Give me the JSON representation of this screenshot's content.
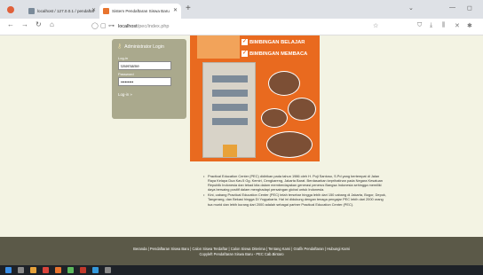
{
  "browser": {
    "tabs": [
      {
        "label": "localhost / 127.0.0.1 / pendaftar"
      },
      {
        "label": "Sistem Pendaftaran Siswa Baru"
      }
    ],
    "url_host": "localhost",
    "url_path": "/pec/index.php"
  },
  "login": {
    "title": "Administrator Login",
    "username_label": "Log-in",
    "username_value": "Username",
    "password_label": "Password",
    "password_value": "•••••••••",
    "submit_label": "Log-in »"
  },
  "banner": {
    "labels": [
      "BIMBINGAN BELAJAR",
      "BIMBINGAN MEMBACA"
    ]
  },
  "description": {
    "paragraphs": [
      "Practical Education Center (PEC) didirikan pada tahun 1986 oleh H. Puji Santoso, S.Pd yang bertempat di Jalan Raya Kelapa Dua Kav.5 Gg. Kemiri, Cengkareng, Jakarta Barat. Berdasarkan keprihatinan pada Negara Kesatuan Republik Indonesia dan tekad kita dalam memberdayakan generasi penerus Bangsa Indonesia sehingga memiliki daya bersaing positif dalam menghadapi persaingan global untuk Indonesia.",
      "Kini, cabang Practical Education Center (PEC) telah tersebar hingga lebih dari 150 cabang di Jakarta, Bogor, Depok, Tangerang, dan Bekasi hingga DI Yogyakarta. Hal ini didukung dengan tenaga pengajar PEC lebih dari 2000 orang tua murid dan lebih kurang dari 2000 adalah sebagai partner Practical Education Center (PEC)."
    ]
  },
  "footer": {
    "links": "Beranda | Pendaftaran Siswa Baru | Calon Siswa Terdaftar | Calon Siswa Diterima | Tentang Kami | Grafik Pendaftaran | Hubungi Kami",
    "copyright": "Copyleft Pendaftaran Siswa Baru - PEC Cab.Bintaro"
  },
  "colors": {
    "page_bg": "#f3f3e3",
    "footer_bg": "#5b5948",
    "banner_orange": "#e96a1f",
    "login_bg": "#aaa98d"
  }
}
